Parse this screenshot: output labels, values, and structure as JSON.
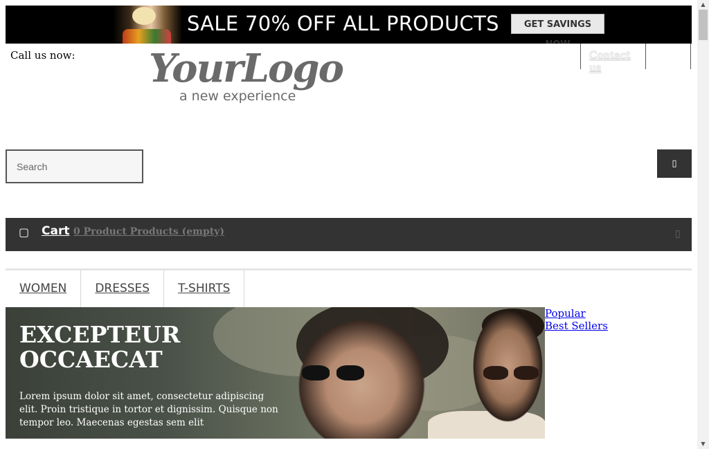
{
  "banner": {
    "headline": "SALE 70% OFF ALL PRODUCTS",
    "cta_label": "GET SAVINGS NOW"
  },
  "header": {
    "call_text": "Call us now:",
    "contact_label": "Contact us",
    "logo_script": "YourLogo",
    "logo_tagline": "a new experience"
  },
  "search": {
    "placeholder": "Search",
    "value": "",
    "button_icon": "search-icon",
    "button_glyph": "▯"
  },
  "cart": {
    "icon": "cart-icon",
    "icon_glyph": "▢",
    "label": "Cart",
    "summary": "0 Product Products (empty)",
    "toggle_glyph": "▯"
  },
  "nav": {
    "items": [
      {
        "label": "WOMEN"
      },
      {
        "label": "DRESSES"
      },
      {
        "label": "T-SHIRTS"
      }
    ]
  },
  "hero": {
    "title": "EXCEPTEUR OCCAECAT",
    "text": "Lorem ipsum dolor sit amet, consectetur adipiscing elit. Proin tristique in tortor et dignissim. Quisque non tempor leo. Maecenas egestas sem elit"
  },
  "side_links": {
    "items": [
      {
        "label": "Popular"
      },
      {
        "label": "Best Sellers"
      }
    ]
  },
  "scrollbar": {
    "up_glyph": "▲",
    "down_glyph": "▼"
  },
  "colors": {
    "banner_bg": "#000000",
    "dark_bar": "#333333",
    "link": "#0000ee"
  }
}
